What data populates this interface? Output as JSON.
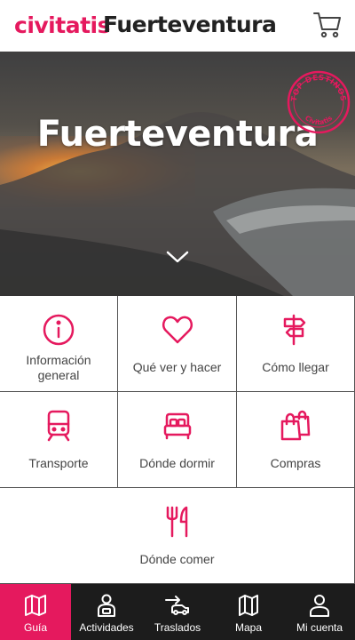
{
  "header": {
    "brand": "civitatis",
    "title": "Fuerteventura",
    "cart_icon": "shopping-cart-icon"
  },
  "hero": {
    "title": "Fuerteventura",
    "badge_text": "TOP DESTINOS",
    "badge_subtext": "Civitatis",
    "scroll_icon": "chevron-down-icon"
  },
  "menu": [
    {
      "label": "Información general",
      "icon": "info-icon"
    },
    {
      "label": "Qué ver y hacer",
      "icon": "heart-icon"
    },
    {
      "label": "Cómo llegar",
      "icon": "signpost-icon"
    },
    {
      "label": "Transporte",
      "icon": "train-icon"
    },
    {
      "label": "Dónde dormir",
      "icon": "bed-icon"
    },
    {
      "label": "Compras",
      "icon": "shopping-bags-icon"
    },
    {
      "label": "Dónde comer",
      "icon": "fork-knife-icon"
    }
  ],
  "bottom_nav": [
    {
      "label": "Guía",
      "icon": "map-book-icon",
      "active": true
    },
    {
      "label": "Actividades",
      "icon": "person-activity-icon",
      "active": false
    },
    {
      "label": "Traslados",
      "icon": "transfer-car-icon",
      "active": false
    },
    {
      "label": "Mapa",
      "icon": "map-icon",
      "active": false
    },
    {
      "label": "Mi cuenta",
      "icon": "user-icon",
      "active": false
    }
  ],
  "colors": {
    "brand": "#e5195e",
    "nav_background": "#1c1c1c",
    "text": "#444444"
  }
}
